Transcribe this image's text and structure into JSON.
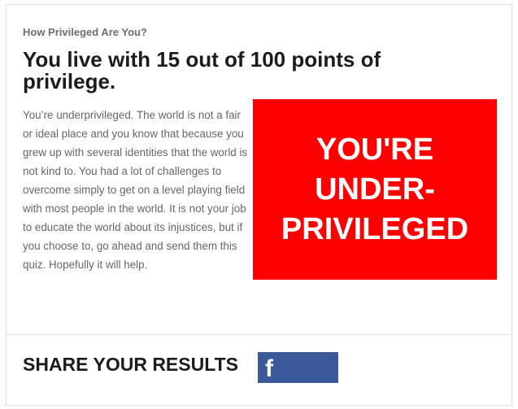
{
  "quiz": {
    "name": "How Privileged Are You?",
    "headline": "You live with 15 out of 100 points of privilege.",
    "description": "You’re underprivileged. The world is not a fair or ideal place and you know that because you grew up with several identities that the world is not kind to. You had a lot of challenges to overcome simply to get on a level playing field with most people in the world. It is not your job to educate the world about its injustices, but if you choose to, go ahead and send them this quiz. Hopefully it will help."
  },
  "result_image": {
    "lines": [
      "YOU'RE",
      "UNDER-",
      "PRIVILEGED"
    ],
    "background_color": "#fe0000",
    "text_color": "#ffffff"
  },
  "share": {
    "label": "SHARE YOUR RESULTS",
    "facebook": {
      "icon": "facebook-icon",
      "glyph": "f",
      "color": "#3b5998"
    }
  }
}
